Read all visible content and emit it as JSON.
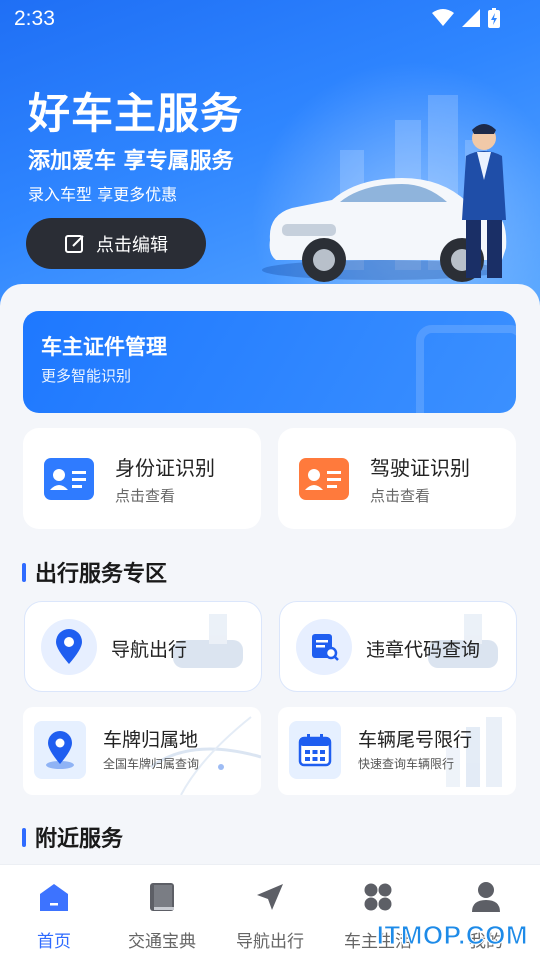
{
  "status_bar": {
    "time": "2:33"
  },
  "hero": {
    "title": "好车主服务",
    "subtitle": "添加爱车 享专属服务",
    "description": "录入车型 享更多优惠",
    "edit_button": "点击编辑"
  },
  "cert_banner": {
    "title": "车主证件管理",
    "subtitle": "更多智能识别"
  },
  "id_cards": [
    {
      "title": "身份证识别",
      "subtitle": "点击查看",
      "icon": "id-card-icon",
      "color": "#2f7bff"
    },
    {
      "title": "驾驶证识别",
      "subtitle": "点击查看",
      "icon": "driver-license-icon",
      "color": "#ff7a3c"
    }
  ],
  "travel_section": {
    "title": "出行服务专区"
  },
  "travel_services": [
    {
      "title": "导航出行",
      "icon": "location-pin-icon"
    },
    {
      "title": "违章代码查询",
      "icon": "document-search-icon"
    }
  ],
  "plate_services": [
    {
      "title": "车牌归属地",
      "subtitle": "全国车牌归属查询",
      "icon": "plate-location-icon"
    },
    {
      "title": "车辆尾号限行",
      "subtitle": "快速查询车辆限行",
      "icon": "calendar-icon"
    }
  ],
  "nearby_section": {
    "title": "附近服务"
  },
  "tabs": [
    {
      "label": "首页",
      "icon": "home-icon",
      "active": true
    },
    {
      "label": "交通宝典",
      "icon": "book-icon",
      "active": false
    },
    {
      "label": "导航出行",
      "icon": "navigation-arrow-icon",
      "active": false
    },
    {
      "label": "车主生活",
      "icon": "grid-icon",
      "active": false
    },
    {
      "label": "我的",
      "icon": "user-icon",
      "active": false
    }
  ],
  "watermark": "ITMOP.COM",
  "colors": {
    "primary": "#2f6bff",
    "hero_start": "#1f6ff5",
    "dark_button": "#2a2d35"
  }
}
